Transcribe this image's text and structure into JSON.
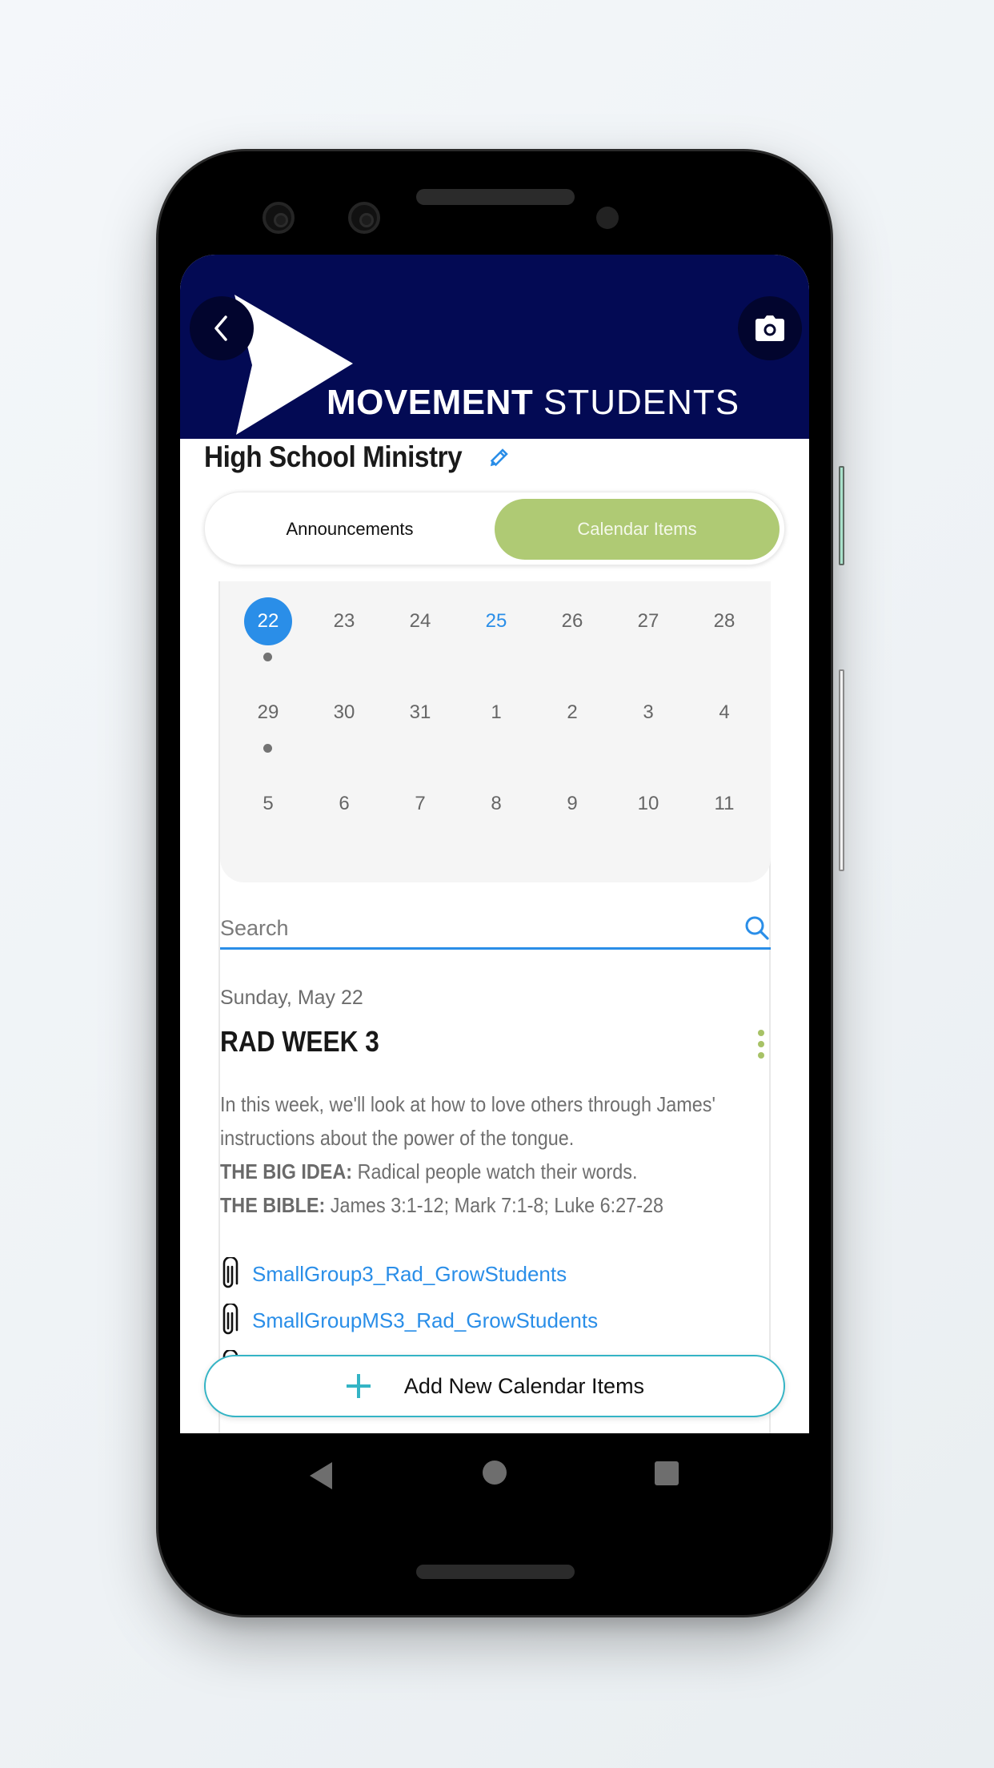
{
  "app": {
    "brand_bold": "MOVEMENT",
    "brand_light": "STUDENTS",
    "header_color": "#030a54",
    "accent_color": "#2a8ee8",
    "tab_active_color": "#afca74"
  },
  "header": {
    "back_icon": "chevron-left-icon",
    "camera_icon": "camera-icon"
  },
  "page": {
    "title": "High School Ministry",
    "edit_icon": "pencil-icon"
  },
  "tabs": [
    {
      "label": "Announcements",
      "active": false
    },
    {
      "label": "Calendar Items",
      "active": true
    }
  ],
  "calendar": {
    "weeks": [
      [
        {
          "day": "22",
          "selected": true,
          "has_event": true
        },
        {
          "day": "23"
        },
        {
          "day": "24"
        },
        {
          "day": "25",
          "today": true
        },
        {
          "day": "26"
        },
        {
          "day": "27"
        },
        {
          "day": "28"
        }
      ],
      [
        {
          "day": "29",
          "has_event": true
        },
        {
          "day": "30"
        },
        {
          "day": "31"
        },
        {
          "day": "1"
        },
        {
          "day": "2"
        },
        {
          "day": "3"
        },
        {
          "day": "4"
        }
      ],
      [
        {
          "day": "5"
        },
        {
          "day": "6"
        },
        {
          "day": "7"
        },
        {
          "day": "8"
        },
        {
          "day": "9"
        },
        {
          "day": "10"
        },
        {
          "day": "11"
        }
      ]
    ]
  },
  "search": {
    "placeholder": "Search",
    "value": ""
  },
  "event": {
    "date": "Sunday, May 22",
    "title": "RAD WEEK 3",
    "description_lines": [
      "In this week, we'll look at how to love others through James'",
      "instructions about the power of the tongue."
    ],
    "big_idea_label": "THE BIG IDEA:",
    "big_idea_text": " Radical people watch their words.",
    "bible_label": "THE BIBLE:",
    "bible_text": " James 3:1-12; Mark 7:1-8; Luke 6:27-28",
    "attachments": [
      "SmallGroup3_Rad_GrowStudents",
      "SmallGroupMS3_Rad_GrowStudents"
    ]
  },
  "add_button": {
    "label": "Add New Calendar Items"
  },
  "system_nav": {
    "back": "back-triangle-icon",
    "home": "home-circle-icon",
    "recents": "recents-square-icon"
  }
}
